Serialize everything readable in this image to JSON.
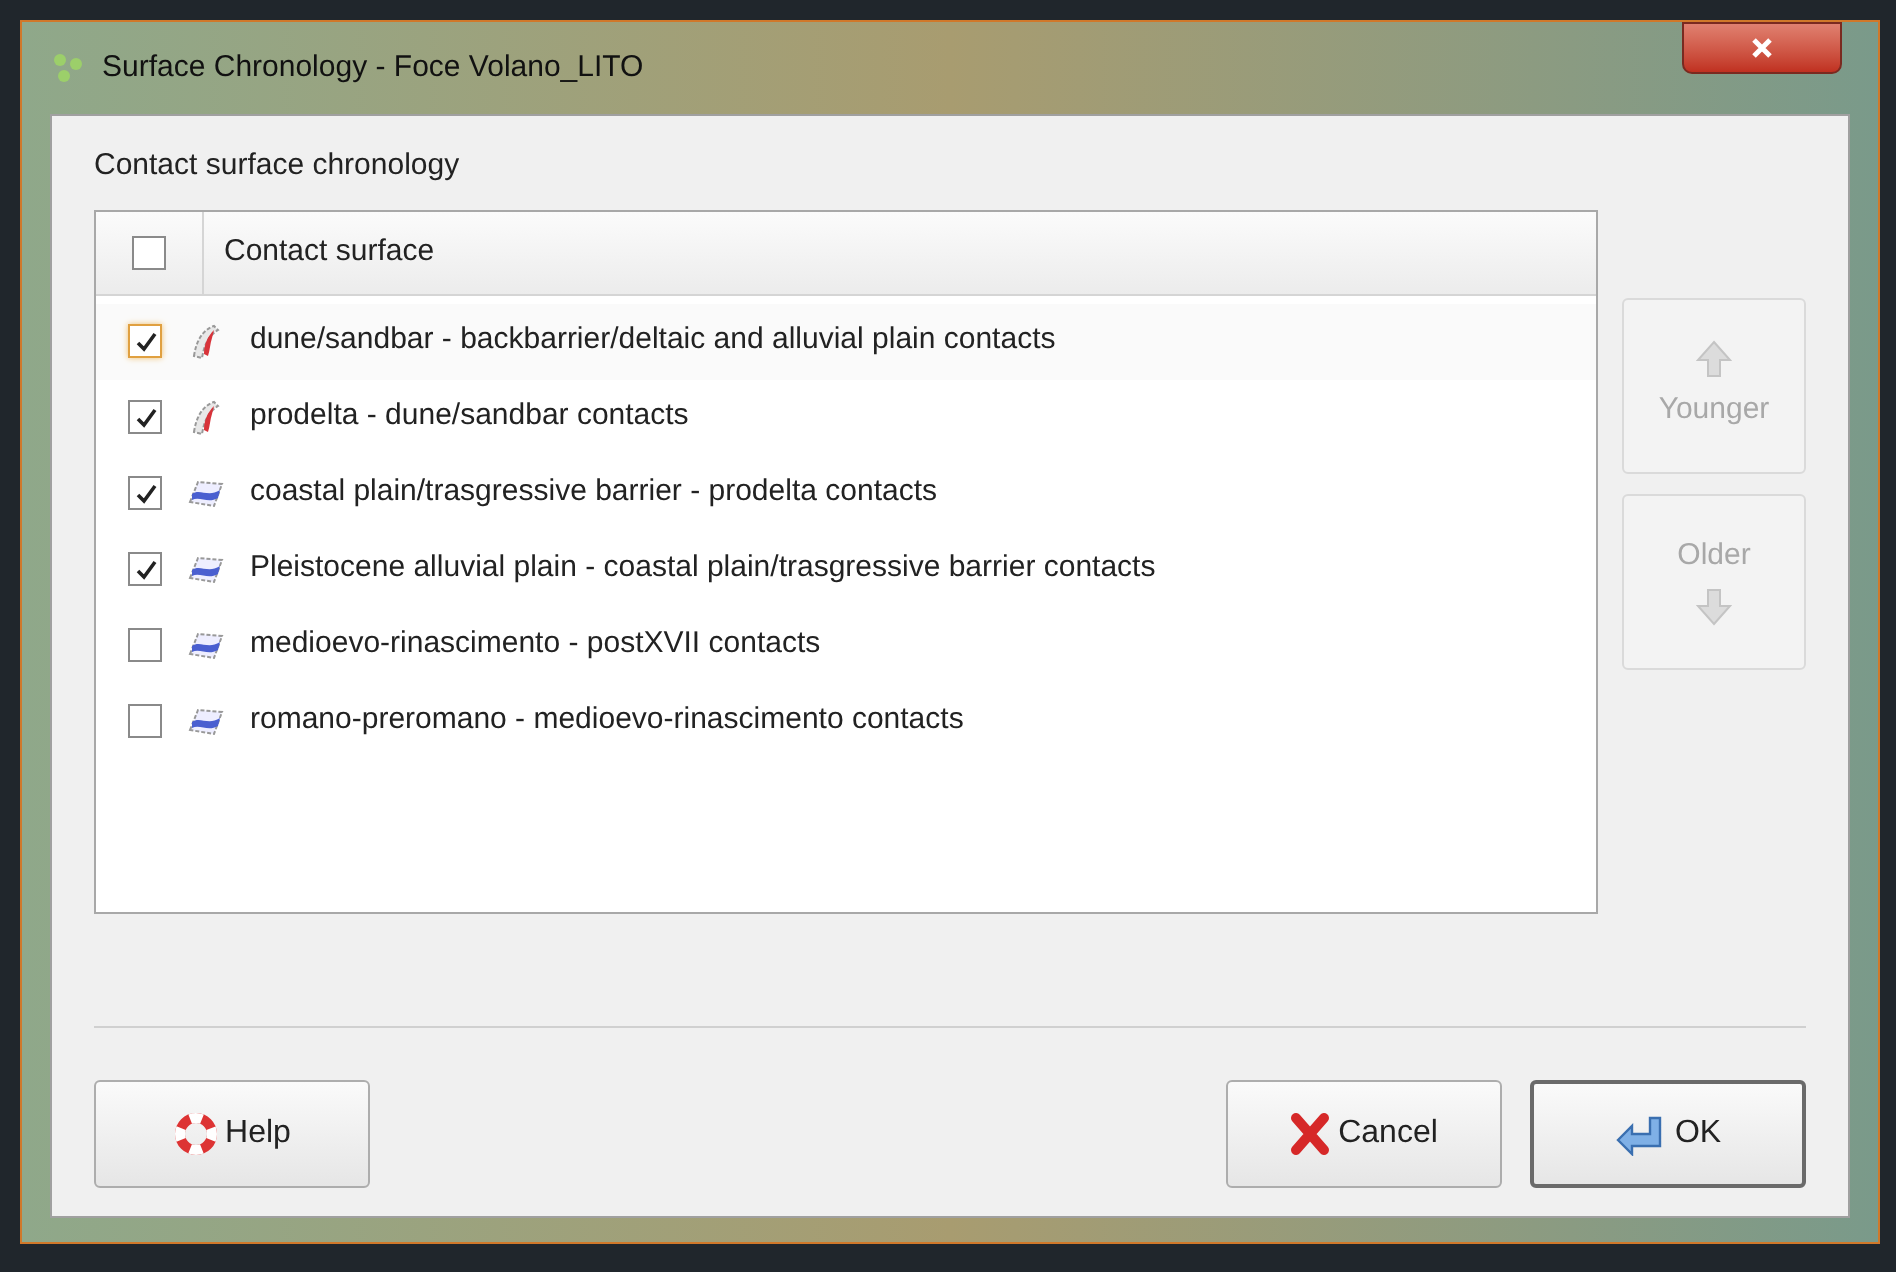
{
  "window": {
    "title": "Surface Chronology - Foce Volano_LITO"
  },
  "group_label": "Contact surface chronology",
  "list": {
    "header": {
      "label": "Contact surface",
      "checked": false
    },
    "items": [
      {
        "label": "dune/sandbar - backbarrier/deltaic and alluvial plain contacts",
        "checked": true,
        "focused": true,
        "kind": "fault"
      },
      {
        "label": "prodelta - dune/sandbar contacts",
        "checked": true,
        "focused": false,
        "kind": "fault"
      },
      {
        "label": "coastal plain/trasgressive barrier - prodelta contacts",
        "checked": true,
        "focused": false,
        "kind": "horizon"
      },
      {
        "label": "Pleistocene alluvial plain - coastal plain/trasgressive barrier contacts",
        "checked": true,
        "focused": false,
        "kind": "horizon"
      },
      {
        "label": "medioevo-rinascimento - postXVII contacts",
        "checked": false,
        "focused": false,
        "kind": "horizon"
      },
      {
        "label": "romano-preromano - medioevo-rinascimento contacts",
        "checked": false,
        "focused": false,
        "kind": "horizon"
      }
    ]
  },
  "order_buttons": [
    {
      "label": "Younger",
      "kind": "up",
      "disabled": true
    },
    {
      "label": "Older",
      "kind": "down",
      "disabled": true
    }
  ],
  "buttons": [
    {
      "label": "Help",
      "kind": "help",
      "default": false
    },
    {
      "label": "Cancel",
      "kind": "cancel",
      "default": false
    },
    {
      "label": "OK",
      "kind": "ok",
      "default": true
    }
  ]
}
